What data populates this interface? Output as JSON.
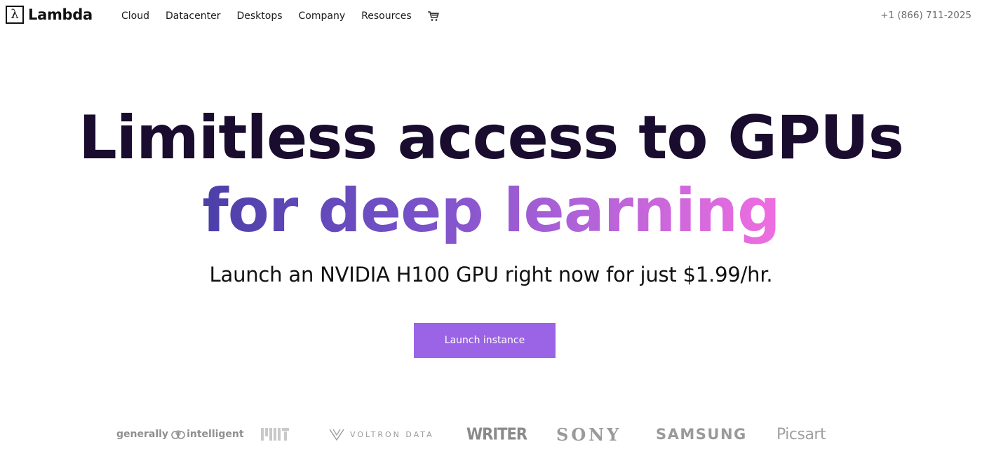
{
  "header": {
    "logo_glyph": "λ",
    "logo_text": "Lambda",
    "nav": [
      {
        "label": "Cloud"
      },
      {
        "label": "Datacenter"
      },
      {
        "label": "Desktops"
      },
      {
        "label": "Company"
      },
      {
        "label": "Resources"
      }
    ],
    "cart_icon": "cart-icon",
    "phone": "+1 (866) 711-2025"
  },
  "hero": {
    "headline_line1": "Limitless access to GPUs",
    "headline_line2": "for deep learning",
    "subtitle": "Launch an NVIDIA H100 GPU right now for just $1.99/hr.",
    "cta_label": "Launch instance",
    "gradient_colors": [
      "#4c3fa8",
      "#7450c7",
      "#b062d8",
      "#f06ee0"
    ],
    "cta_color": "#9b63e6"
  },
  "logos": {
    "generally_intelligent": {
      "left": "generally",
      "right": "intelligent"
    },
    "mit": "MIT",
    "voltron": "VOLTRON DATA",
    "writer": "WRITER",
    "sony": "SONY",
    "samsung": "SAMSUNG",
    "picsart": "Picsart"
  }
}
